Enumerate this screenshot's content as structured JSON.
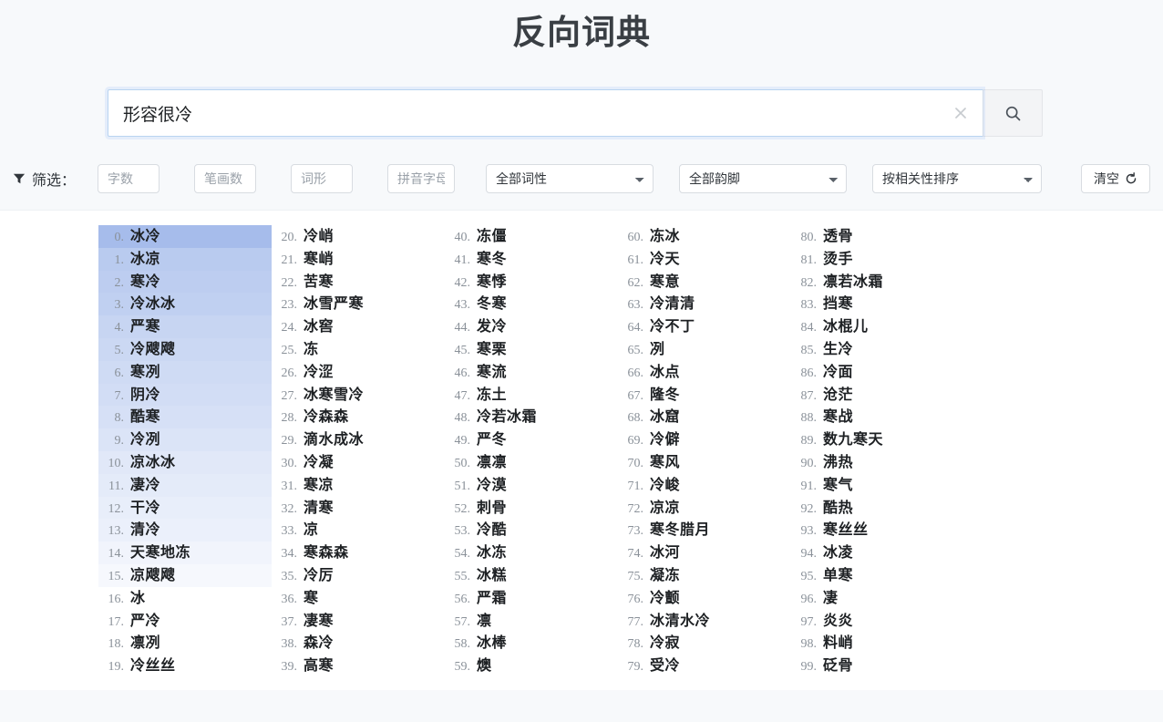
{
  "header": {
    "title": "反向词典"
  },
  "search": {
    "value": "形容很冷",
    "placeholder": "",
    "clear_icon": "close-icon",
    "search_icon": "search-icon"
  },
  "filters": {
    "label": "筛选：",
    "funnel_icon": "funnel-icon",
    "fields": [
      {
        "name": "word-length",
        "placeholder": "字数",
        "value": ""
      },
      {
        "name": "stroke-count",
        "placeholder": "笔画数",
        "value": ""
      },
      {
        "name": "word-shape",
        "placeholder": "词形",
        "value": ""
      },
      {
        "name": "pinyin-letters",
        "placeholder": "拼音字母",
        "value": ""
      }
    ],
    "selects": [
      {
        "name": "part-of-speech",
        "selected": "全部词性"
      },
      {
        "name": "rhyme",
        "selected": "全部韵脚"
      },
      {
        "name": "sort-order",
        "selected": "按相关性排序"
      }
    ],
    "clear_button": {
      "label": "清空",
      "icon": "refresh-icon"
    }
  },
  "results": {
    "columns": [
      {
        "items": [
          {
            "index": "0.",
            "word": "冰冷",
            "highlight": 1.0
          },
          {
            "index": "1.",
            "word": "冰凉",
            "highlight": 0.78
          },
          {
            "index": "2.",
            "word": "寒冷",
            "highlight": 0.74
          },
          {
            "index": "3.",
            "word": "冷冰冰",
            "highlight": 0.7
          },
          {
            "index": "4.",
            "word": "严寒",
            "highlight": 0.62
          },
          {
            "index": "5.",
            "word": "冷飕飕",
            "highlight": 0.58
          },
          {
            "index": "6.",
            "word": "寒冽",
            "highlight": 0.54
          },
          {
            "index": "7.",
            "word": "阴冷",
            "highlight": 0.5
          },
          {
            "index": "8.",
            "word": "酷寒",
            "highlight": 0.46
          },
          {
            "index": "9.",
            "word": "冷冽",
            "highlight": 0.4
          },
          {
            "index": "10.",
            "word": "凉冰冰",
            "highlight": 0.34
          },
          {
            "index": "11.",
            "word": "凄冷",
            "highlight": 0.3
          },
          {
            "index": "12.",
            "word": "干冷",
            "highlight": 0.26
          },
          {
            "index": "13.",
            "word": "清冷",
            "highlight": 0.22
          },
          {
            "index": "14.",
            "word": "天寒地冻",
            "highlight": 0.16
          },
          {
            "index": "15.",
            "word": "凉飕飕",
            "highlight": 0.1
          },
          {
            "index": "16.",
            "word": "冰",
            "highlight": 0.0
          },
          {
            "index": "17.",
            "word": "严冷",
            "highlight": 0.0
          },
          {
            "index": "18.",
            "word": "凛冽",
            "highlight": 0.0
          },
          {
            "index": "19.",
            "word": "冷丝丝",
            "highlight": 0.0
          }
        ]
      },
      {
        "items": [
          {
            "index": "20.",
            "word": "冷峭",
            "highlight": 0.0
          },
          {
            "index": "21.",
            "word": "寒峭",
            "highlight": 0.0
          },
          {
            "index": "22.",
            "word": "苦寒",
            "highlight": 0.0
          },
          {
            "index": "23.",
            "word": "冰雪严寒",
            "highlight": 0.0
          },
          {
            "index": "24.",
            "word": "冰窖",
            "highlight": 0.0
          },
          {
            "index": "25.",
            "word": "冻",
            "highlight": 0.0
          },
          {
            "index": "26.",
            "word": "冷涩",
            "highlight": 0.0
          },
          {
            "index": "27.",
            "word": "冰寒雪冷",
            "highlight": 0.0
          },
          {
            "index": "28.",
            "word": "冷森森",
            "highlight": 0.0
          },
          {
            "index": "29.",
            "word": "滴水成冰",
            "highlight": 0.0
          },
          {
            "index": "30.",
            "word": "冷凝",
            "highlight": 0.0
          },
          {
            "index": "31.",
            "word": "寒凉",
            "highlight": 0.0
          },
          {
            "index": "32.",
            "word": "清寒",
            "highlight": 0.0
          },
          {
            "index": "33.",
            "word": "凉",
            "highlight": 0.0
          },
          {
            "index": "34.",
            "word": "寒森森",
            "highlight": 0.0
          },
          {
            "index": "35.",
            "word": "冷厉",
            "highlight": 0.0
          },
          {
            "index": "36.",
            "word": "寒",
            "highlight": 0.0
          },
          {
            "index": "37.",
            "word": "凄寒",
            "highlight": 0.0
          },
          {
            "index": "38.",
            "word": "森冷",
            "highlight": 0.0
          },
          {
            "index": "39.",
            "word": "高寒",
            "highlight": 0.0
          }
        ]
      },
      {
        "items": [
          {
            "index": "40.",
            "word": "冻僵",
            "highlight": 0.0
          },
          {
            "index": "41.",
            "word": "寒冬",
            "highlight": 0.0
          },
          {
            "index": "42.",
            "word": "寒悸",
            "highlight": 0.0
          },
          {
            "index": "43.",
            "word": "冬寒",
            "highlight": 0.0
          },
          {
            "index": "44.",
            "word": "发冷",
            "highlight": 0.0
          },
          {
            "index": "45.",
            "word": "寒栗",
            "highlight": 0.0
          },
          {
            "index": "46.",
            "word": "寒流",
            "highlight": 0.0
          },
          {
            "index": "47.",
            "word": "冻土",
            "highlight": 0.0
          },
          {
            "index": "48.",
            "word": "冷若冰霜",
            "highlight": 0.0
          },
          {
            "index": "49.",
            "word": "严冬",
            "highlight": 0.0
          },
          {
            "index": "50.",
            "word": "凛凛",
            "highlight": 0.0
          },
          {
            "index": "51.",
            "word": "冷漠",
            "highlight": 0.0
          },
          {
            "index": "52.",
            "word": "刺骨",
            "highlight": 0.0
          },
          {
            "index": "53.",
            "word": "冷酷",
            "highlight": 0.0
          },
          {
            "index": "54.",
            "word": "冰冻",
            "highlight": 0.0
          },
          {
            "index": "55.",
            "word": "冰糕",
            "highlight": 0.0
          },
          {
            "index": "56.",
            "word": "严霜",
            "highlight": 0.0
          },
          {
            "index": "57.",
            "word": "凛",
            "highlight": 0.0
          },
          {
            "index": "58.",
            "word": "冰棒",
            "highlight": 0.0
          },
          {
            "index": "59.",
            "word": "燠",
            "highlight": 0.0
          }
        ]
      },
      {
        "items": [
          {
            "index": "60.",
            "word": "冻冰",
            "highlight": 0.0
          },
          {
            "index": "61.",
            "word": "冷天",
            "highlight": 0.0
          },
          {
            "index": "62.",
            "word": "寒意",
            "highlight": 0.0
          },
          {
            "index": "63.",
            "word": "冷清清",
            "highlight": 0.0
          },
          {
            "index": "64.",
            "word": "冷不丁",
            "highlight": 0.0
          },
          {
            "index": "65.",
            "word": "冽",
            "highlight": 0.0
          },
          {
            "index": "66.",
            "word": "冰点",
            "highlight": 0.0
          },
          {
            "index": "67.",
            "word": "隆冬",
            "highlight": 0.0
          },
          {
            "index": "68.",
            "word": "冰窟",
            "highlight": 0.0
          },
          {
            "index": "69.",
            "word": "冷僻",
            "highlight": 0.0
          },
          {
            "index": "70.",
            "word": "寒风",
            "highlight": 0.0
          },
          {
            "index": "71.",
            "word": "冷峻",
            "highlight": 0.0
          },
          {
            "index": "72.",
            "word": "凉凉",
            "highlight": 0.0
          },
          {
            "index": "73.",
            "word": "寒冬腊月",
            "highlight": 0.0
          },
          {
            "index": "74.",
            "word": "冰河",
            "highlight": 0.0
          },
          {
            "index": "75.",
            "word": "凝冻",
            "highlight": 0.0
          },
          {
            "index": "76.",
            "word": "冷颤",
            "highlight": 0.0
          },
          {
            "index": "77.",
            "word": "冰清水冷",
            "highlight": 0.0
          },
          {
            "index": "78.",
            "word": "冷寂",
            "highlight": 0.0
          },
          {
            "index": "79.",
            "word": "受冷",
            "highlight": 0.0
          }
        ]
      },
      {
        "items": [
          {
            "index": "80.",
            "word": "透骨",
            "highlight": 0.0
          },
          {
            "index": "81.",
            "word": "烫手",
            "highlight": 0.0
          },
          {
            "index": "82.",
            "word": "凛若冰霜",
            "highlight": 0.0
          },
          {
            "index": "83.",
            "word": "挡寒",
            "highlight": 0.0
          },
          {
            "index": "84.",
            "word": "冰棍儿",
            "highlight": 0.0
          },
          {
            "index": "85.",
            "word": "生冷",
            "highlight": 0.0
          },
          {
            "index": "86.",
            "word": "冷面",
            "highlight": 0.0
          },
          {
            "index": "87.",
            "word": "沧茫",
            "highlight": 0.0
          },
          {
            "index": "88.",
            "word": "寒战",
            "highlight": 0.0
          },
          {
            "index": "89.",
            "word": "数九寒天",
            "highlight": 0.0
          },
          {
            "index": "90.",
            "word": "沸热",
            "highlight": 0.0
          },
          {
            "index": "91.",
            "word": "寒气",
            "highlight": 0.0
          },
          {
            "index": "92.",
            "word": "酷热",
            "highlight": 0.0
          },
          {
            "index": "93.",
            "word": "寒丝丝",
            "highlight": 0.0
          },
          {
            "index": "94.",
            "word": "冰凌",
            "highlight": 0.0
          },
          {
            "index": "95.",
            "word": "单寒",
            "highlight": 0.0
          },
          {
            "index": "96.",
            "word": "凄",
            "highlight": 0.0
          },
          {
            "index": "97.",
            "word": "炎炎",
            "highlight": 0.0
          },
          {
            "index": "98.",
            "word": "料峭",
            "highlight": 0.0
          },
          {
            "index": "99.",
            "word": "砭骨",
            "highlight": 0.0
          }
        ]
      }
    ]
  },
  "colors": {
    "page_background": "#f7f9fb",
    "panel_background": "#ffffff",
    "title_text": "#3a3f44",
    "highlight": "#a8c0ee",
    "focus_border": "#b9d4f0",
    "index_text": "#8a9199",
    "word_text": "#1d2023"
  }
}
